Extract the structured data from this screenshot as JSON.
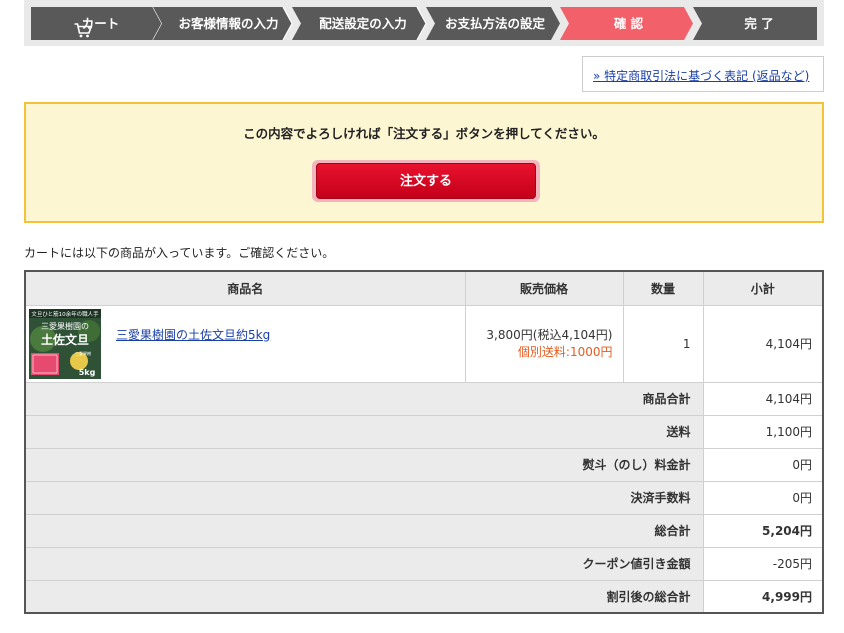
{
  "steps": [
    {
      "label": "カート",
      "state": "done",
      "icon": "cart-icon"
    },
    {
      "label": "お客様情報の入力",
      "state": "done"
    },
    {
      "label": "配送設定の入力",
      "state": "done"
    },
    {
      "label": "お支払方法の設定",
      "state": "done"
    },
    {
      "label": "確 認",
      "state": "active"
    },
    {
      "label": "完 了",
      "state": "todo"
    }
  ],
  "colors": {
    "step_done": "#595959",
    "step_active": "#f2606a",
    "step_todo": "#595959",
    "confirm_bg": "#fdf6d3",
    "confirm_border": "#f4c23a",
    "order_button": "#d9061f"
  },
  "legal_link": "» 特定商取引法に基づく表記 (返品など)",
  "confirm": {
    "message": "この内容でよろしければ「注文する」ボタンを押してください。",
    "button": "注文する"
  },
  "cart_note": "カートには以下の商品が入っています。ご確認ください。",
  "table": {
    "headers": {
      "name": "商品名",
      "price": "販売価格",
      "qty": "数量",
      "subtotal": "小計"
    },
    "items": [
      {
        "name": "三愛果樹園の土佐文旦約5kg",
        "price": "3,800円(税込4,104円)",
        "shipping_note": "個別送料:1000円",
        "qty": "1",
        "subtotal": "4,104円",
        "thumb": {
          "top_text": "文旦ひと筋10余年の職人手",
          "brand": "三愛果樹園の",
          "product": "土佐文旦",
          "weight": "5kg",
          "tag": "三愛果樹"
        }
      }
    ],
    "summary": [
      {
        "label": "商品合計",
        "value": "4,104円",
        "strong": false
      },
      {
        "label": "送料",
        "value": "1,100円",
        "strong": false
      },
      {
        "label": "熨斗（のし）料金計",
        "value": "0円",
        "strong": false
      },
      {
        "label": "決済手数料",
        "value": "0円",
        "strong": false
      },
      {
        "label": "総合計",
        "value": "5,204円",
        "strong": true
      },
      {
        "label": "クーポン値引き金額",
        "value": "-205円",
        "strong": false
      },
      {
        "label": "割引後の総合計",
        "value": "4,999円",
        "strong": true
      }
    ]
  }
}
